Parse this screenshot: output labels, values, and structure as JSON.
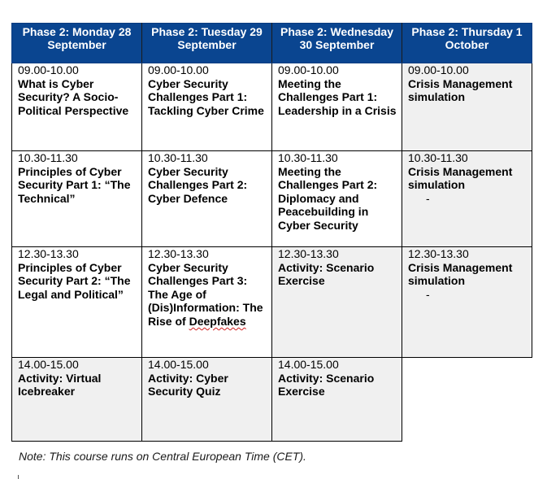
{
  "header": {
    "columns": [
      "Phase 2: Monday 28 September",
      "Phase 2: Tuesday 29 September",
      "Phase 2: Wednesday 30 September",
      "Phase 2: Thursday 1 October"
    ]
  },
  "rows": [
    {
      "cells": [
        {
          "time": "09.00-10.00",
          "title": "What is Cyber Security? A Socio-Political Perspective"
        },
        {
          "time": "09.00-10.00",
          "title": "Cyber Security Challenges Part 1: Tackling Cyber Crime"
        },
        {
          "time": "09.00-10.00",
          "title": "Meeting the Challenges Part 1: Leadership in a Crisis"
        },
        {
          "time": "09.00-10.00",
          "title": "Crisis Management simulation"
        }
      ]
    },
    {
      "cells": [
        {
          "time": "10.30-11.30",
          "title": "Principles of Cyber Security Part 1: “The Technical”"
        },
        {
          "time": "10.30-11.30",
          "title": "Cyber Security Challenges Part 2: Cyber Defence"
        },
        {
          "time": "10.30-11.30",
          "title": "Meeting the Challenges Part 2: Diplomacy and Peacebuilding in Cyber Security"
        },
        {
          "time": "10.30-11.30",
          "title": "Crisis Management simulation",
          "extra": "-"
        }
      ]
    },
    {
      "cells": [
        {
          "time": "12.30-13.30",
          "title": "Principles of Cyber Security Part 2: “The Legal and Political”"
        },
        {
          "time": "12.30-13.30",
          "title": "Cyber Security Challenges Part 3: The Age of (Dis)Information: The Rise of",
          "title_flagged": "Deepfakes"
        },
        {
          "time": "12.30-13.30",
          "title": "Activity: Scenario Exercise"
        },
        {
          "time": "12.30-13.30",
          "title": "Crisis Management simulation",
          "extra": "-"
        }
      ]
    },
    {
      "cells": [
        {
          "time": "14.00-15.00",
          "title": "Activity: Virtual Icebreaker"
        },
        {
          "time": "14.00-15.00",
          "title": "Activity: Cyber Security Quiz"
        },
        {
          "time": "14.00-15.00",
          "title": "Activity: Scenario Exercise"
        }
      ]
    }
  ],
  "note": "Note: This course runs on Central European Time (CET).",
  "colors": {
    "header_bg": "#0a4590",
    "header_text": "#ffffff",
    "shaded_cell": "#f0f0f0",
    "spellcheck_underline": "#d02020"
  }
}
